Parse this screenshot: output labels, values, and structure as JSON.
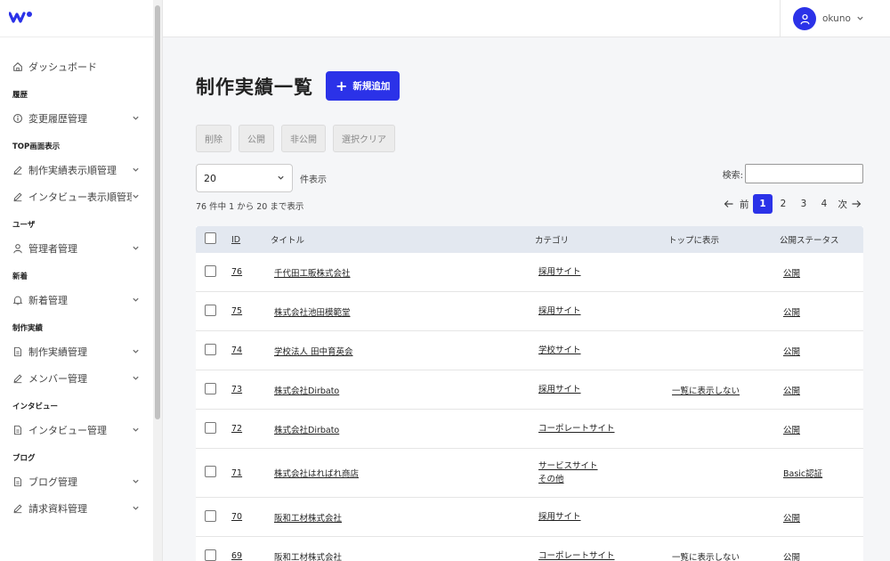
{
  "colors": {
    "accent": "#2b32e8",
    "header_bg": "#e3e8f0"
  },
  "sidebar": {
    "logo": "logo-icon",
    "sections": [
      {
        "type": "item",
        "label": "ダッシュボード",
        "icon": "home-icon",
        "chevron": false
      },
      {
        "type": "section",
        "label": "履歴"
      },
      {
        "type": "item",
        "label": "変更履歴管理",
        "icon": "info-icon",
        "chevron": true
      },
      {
        "type": "section",
        "label": "TOP画面表示"
      },
      {
        "type": "item",
        "label": "制作実績表示順管理",
        "icon": "pencil-icon",
        "chevron": true
      },
      {
        "type": "item",
        "label": "インタビュー表示順管理",
        "icon": "pencil-icon",
        "chevron": true
      },
      {
        "type": "section",
        "label": "ユーザ"
      },
      {
        "type": "item",
        "label": "管理者管理",
        "icon": "user-icon",
        "chevron": true
      },
      {
        "type": "section",
        "label": "新着"
      },
      {
        "type": "item",
        "label": "新着管理",
        "icon": "bell-icon",
        "chevron": true
      },
      {
        "type": "section",
        "label": "制作実績"
      },
      {
        "type": "item",
        "label": "制作実績管理",
        "icon": "document-icon",
        "chevron": true
      },
      {
        "type": "item",
        "label": "メンバー管理",
        "icon": "pencil-icon",
        "chevron": true
      },
      {
        "type": "section",
        "label": "インタビュー"
      },
      {
        "type": "item",
        "label": "インタビュー管理",
        "icon": "document-icon",
        "chevron": true
      },
      {
        "type": "section",
        "label": "ブログ"
      },
      {
        "type": "item",
        "label": "ブログ管理",
        "icon": "document-icon",
        "chevron": true
      },
      {
        "type": "item",
        "label": "請求資料管理",
        "icon": "pencil-icon",
        "chevron": true
      }
    ]
  },
  "header": {
    "username": "okuno"
  },
  "main": {
    "title": "制作実績一覧",
    "add_button": "新規追加",
    "bulk_actions": [
      "削除",
      "公開",
      "非公開",
      "選択クリア"
    ],
    "page_length": {
      "value": "20",
      "label": "件表示"
    },
    "search_label": "検索:",
    "info": "76 件中 1 から 20 まで表示",
    "pager": {
      "prev": "前",
      "next": "次",
      "pages": [
        "1",
        "2",
        "3",
        "4"
      ],
      "current": "1"
    },
    "columns": {
      "id": "ID",
      "title": "タイトル",
      "category": "カテゴリ",
      "top": "トップに表示",
      "status": "公開ステータス"
    },
    "rows": [
      {
        "id": "76",
        "title": "千代田工販株式会社",
        "categories": [
          "採用サイト"
        ],
        "top": "",
        "status": "公開"
      },
      {
        "id": "75",
        "title": "株式会社池田模範堂",
        "categories": [
          "採用サイト"
        ],
        "top": "",
        "status": "公開"
      },
      {
        "id": "74",
        "title": "学校法人 田中育英会",
        "categories": [
          "学校サイト"
        ],
        "top": "",
        "status": "公開"
      },
      {
        "id": "73",
        "title": "株式会社Dirbato",
        "categories": [
          "採用サイト"
        ],
        "top": "一覧に表示しない",
        "status": "公開"
      },
      {
        "id": "72",
        "title": "株式会社Dirbato",
        "categories": [
          "コーポレートサイト"
        ],
        "top": "",
        "status": "公開"
      },
      {
        "id": "71",
        "title": "株式会社はればれ商店",
        "categories": [
          "サービスサイト",
          "その他"
        ],
        "top": "",
        "status": "Basic認証"
      },
      {
        "id": "70",
        "title": "阪和工材株式会社",
        "categories": [
          "採用サイト"
        ],
        "top": "",
        "status": "公開"
      },
      {
        "id": "69",
        "title": "阪和工材株式会社",
        "categories": [
          "コーポレートサイト"
        ],
        "top": "一覧に表示しない",
        "status": "公開"
      }
    ]
  }
}
